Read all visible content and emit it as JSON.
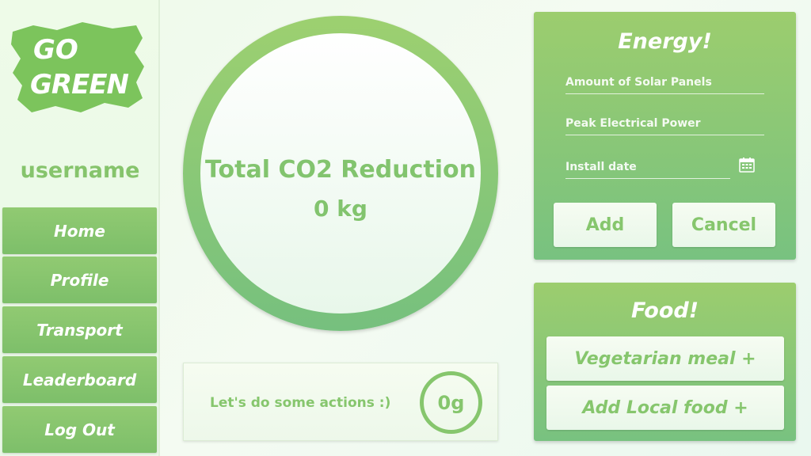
{
  "brand": {
    "logo_line1": "GO",
    "logo_line2": "GREEN"
  },
  "sidebar": {
    "username": "username",
    "items": [
      {
        "label": "Home"
      },
      {
        "label": "Profile"
      },
      {
        "label": "Transport"
      },
      {
        "label": "Leaderboard"
      },
      {
        "label": "Log Out"
      }
    ]
  },
  "main": {
    "co2_title": "Total CO2 Reduction",
    "co2_value": "0 kg",
    "actions_text": "Let's do some actions :)",
    "actions_value": "0g"
  },
  "energy": {
    "title": "Energy!",
    "solar_panels_placeholder": "Amount of Solar Panels",
    "peak_power_placeholder": "Peak Electrical Power",
    "install_date_placeholder": "Install date",
    "add_label": "Add",
    "cancel_label": "Cancel"
  },
  "food": {
    "title": "Food!",
    "vegetarian_label": "Vegetarian meal +",
    "local_food_label": "Add Local food +"
  },
  "colors": {
    "accent": "#86c66d",
    "panel_top": "#9ccd6e",
    "panel_bottom": "#78c280",
    "background": "#eef9ea"
  },
  "icons": {
    "logo": "go-green-brush-logo",
    "calendar": "calendar-icon"
  }
}
